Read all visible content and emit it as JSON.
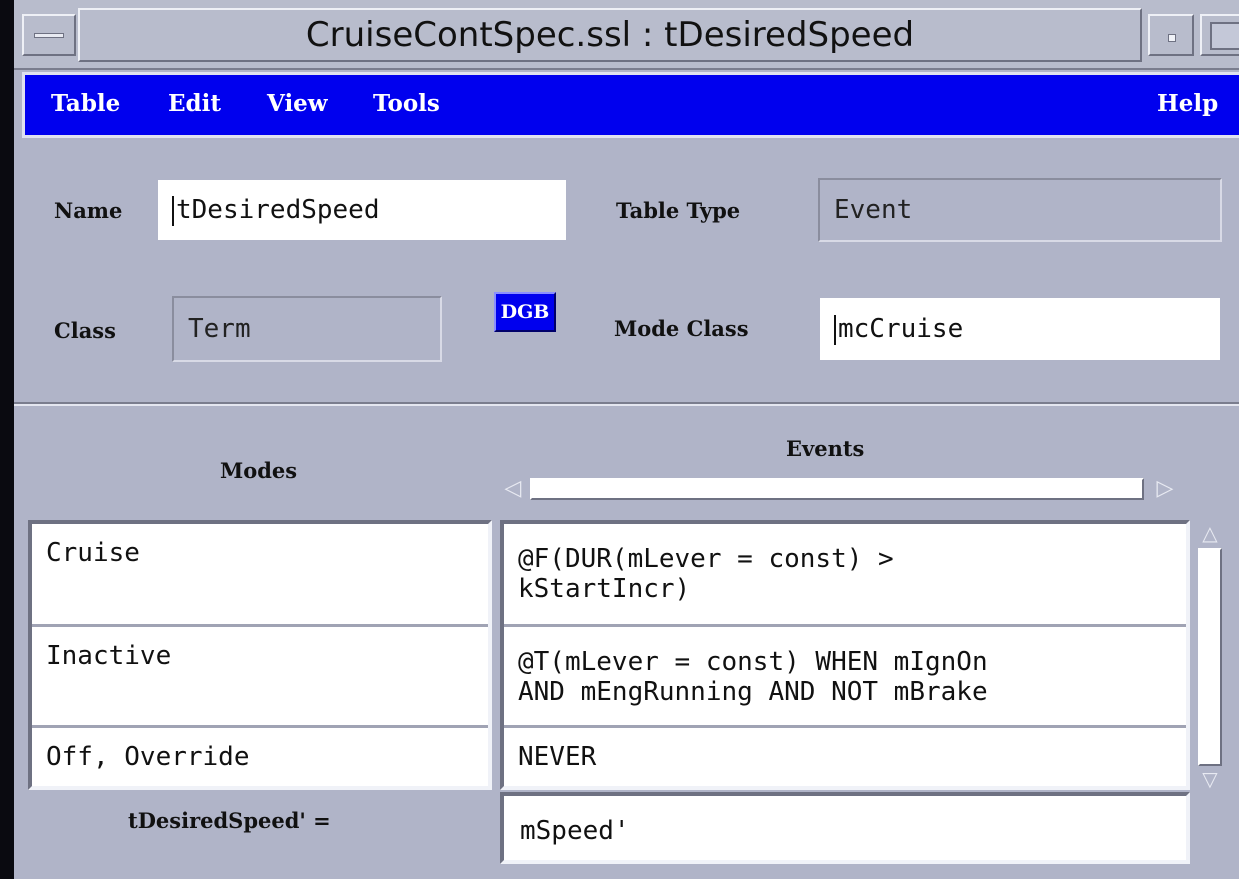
{
  "window": {
    "title": "CruiseContSpec.ssl : tDesiredSpeed"
  },
  "menubar": {
    "items": [
      "Table",
      "Edit",
      "View",
      "Tools"
    ],
    "help": "Help"
  },
  "form": {
    "name_label": "Name",
    "name_value": "tDesiredSpeed",
    "table_type_label": "Table Type",
    "table_type_value": "Event",
    "class_label": "Class",
    "class_value": "Term",
    "dgb_label": "DGB",
    "mode_class_label": "Mode Class",
    "mode_class_value": "mcCruise"
  },
  "table": {
    "modes_header": "Modes",
    "events_header": "Events",
    "rows": [
      {
        "mode": "Cruise",
        "event": "@F(DUR(mLever = const) >\nkStartIncr)"
      },
      {
        "mode": "Inactive",
        "event": "@T(mLever = const) WHEN mIgnOn\nAND mEngRunning AND NOT mBrake"
      },
      {
        "mode": "Off,   Override",
        "event": "NEVER"
      }
    ],
    "result_label": "tDesiredSpeed' =",
    "result_value": "mSpeed'"
  },
  "colors": {
    "menubar_bg": "#0000ee",
    "window_bg": "#b0b4c8"
  }
}
